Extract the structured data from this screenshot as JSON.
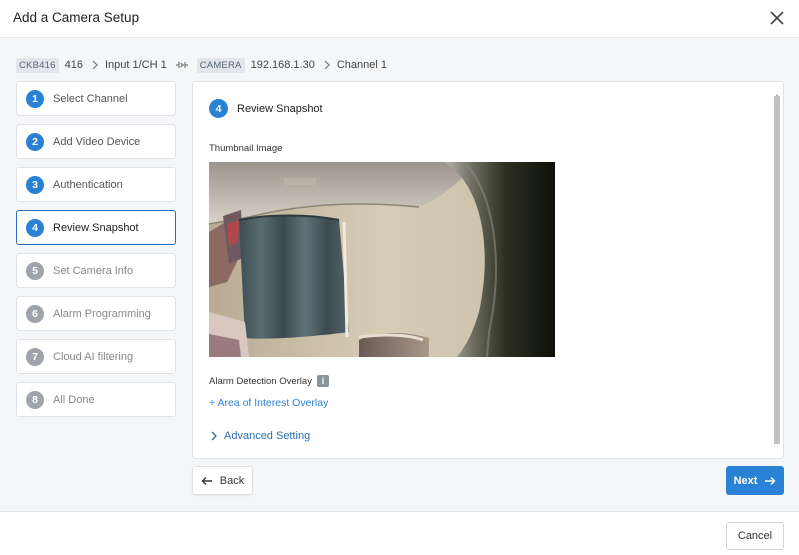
{
  "dialog": {
    "title": "Add a Camera Setup"
  },
  "breadcrumb": {
    "device_tag": "CKB416",
    "device_id": "416",
    "input": "Input 1/CH 1",
    "camera_tag": "CAMERA",
    "camera_ip": "192.168.1.30",
    "channel": "Channel 1"
  },
  "steps": [
    {
      "num": "1",
      "label": "Select Channel",
      "state": "done"
    },
    {
      "num": "2",
      "label": "Add Video Device",
      "state": "done"
    },
    {
      "num": "3",
      "label": "Authentication",
      "state": "done"
    },
    {
      "num": "4",
      "label": "Review Snapshot",
      "state": "active"
    },
    {
      "num": "5",
      "label": "Set Camera Info",
      "state": "todo"
    },
    {
      "num": "6",
      "label": "Alarm Programming",
      "state": "todo"
    },
    {
      "num": "7",
      "label": "Cloud AI filtering",
      "state": "todo"
    },
    {
      "num": "8",
      "label": "All Done",
      "state": "todo"
    }
  ],
  "panel": {
    "step_num": "4",
    "title": "Review Snapshot",
    "thumbnail_label": "Thumbnail Image",
    "alarm_overlay_label": "Alarm Detection Overlay",
    "info_icon": "i",
    "aoi_link": "+ Area of Interest Overlay",
    "advanced_setting": "Advanced Setting"
  },
  "buttons": {
    "back": "Back",
    "next": "Next",
    "cancel": "Cancel"
  },
  "icons": {
    "close": "close-icon",
    "chevron": "chevron-right-icon",
    "link": "link-icon",
    "info": "info-icon",
    "back": "arrow-left-icon",
    "next": "arrow-right-icon"
  },
  "colors": {
    "primary": "#2a82d6",
    "step_todo": "#9ea4aa",
    "active_border": "#2a6fb6"
  }
}
